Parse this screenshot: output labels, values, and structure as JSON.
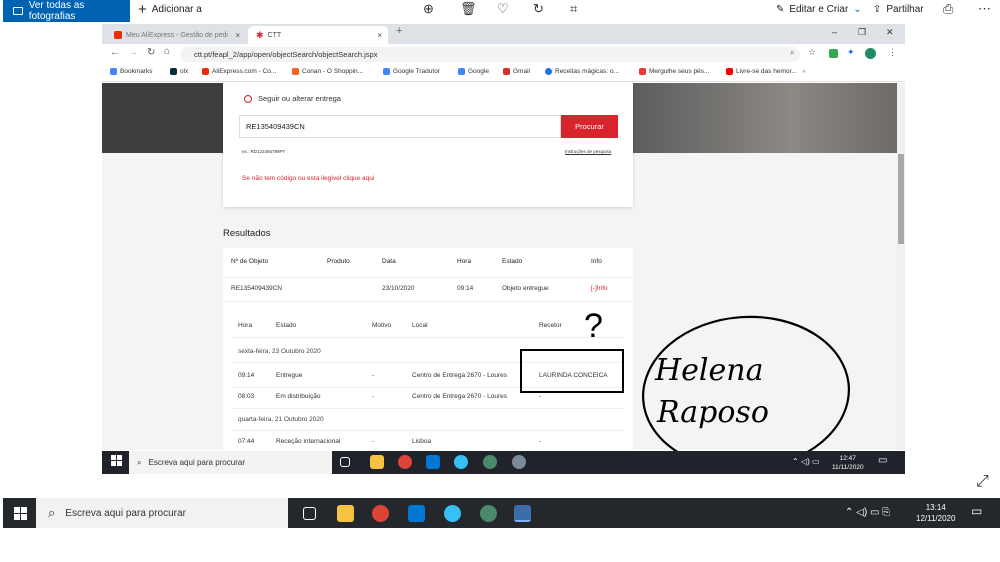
{
  "photos_toolbar": {
    "see_all": "Ver todas as fotografias",
    "add": "Adicionar a",
    "edit_create": "Editar e Criar",
    "share": "Partilhar"
  },
  "browser": {
    "tabs": [
      {
        "label": "Meu AliExpress - Gestão de pedi"
      },
      {
        "label": "CTT"
      }
    ],
    "url": "ctt.pt/feapl_2/app/open/objectSearch/objectSearch.jspx",
    "bookmarks": [
      {
        "label": "Bookmarks",
        "color": "#4285f4"
      },
      {
        "label": "olx",
        "color": "#002f34"
      },
      {
        "label": "AliExpress.com - Co...",
        "color": "#e62e04"
      },
      {
        "label": "Conan - O Shoppin...",
        "color": "#f26522"
      },
      {
        "label": "Google Tradutor",
        "color": "#4285f4"
      },
      {
        "label": "Google",
        "color": "#4285f4"
      },
      {
        "label": "Gmail",
        "color": "#d93025"
      },
      {
        "label": "Receitas mágicas: o...",
        "color": "#1a73e8"
      },
      {
        "label": "Mergulhe seus pés...",
        "color": "#e53935"
      },
      {
        "label": "Livre-se das hemor...",
        "color": "#ff0000"
      }
    ]
  },
  "search_card": {
    "heading": "Seguir ou alterar entrega",
    "input_value": "RE135409439CN",
    "button": "Procurar",
    "example": "ex.: RD123456789PT",
    "instructions": "Instruções de pesquisa",
    "no_code": "Se não tem código ou esta ilegível clique aqui"
  },
  "results": {
    "title": "Resultados",
    "columns": [
      "Nº de Objeto",
      "Produto",
      "Data",
      "Hora",
      "Estado",
      "Info"
    ],
    "row": {
      "object": "RE135409439CN",
      "product": "",
      "date": "23/10/2020",
      "time": "09:14",
      "status": "Objeto entregue",
      "info": "[-]Info"
    },
    "detail_columns": [
      "Hora",
      "Estado",
      "Motivo",
      "Local",
      "Recetor"
    ],
    "days": [
      {
        "label": "sexta-feira, 23 Outubro 2020",
        "events": [
          {
            "time": "09:14",
            "status": "Entregue",
            "reason": "-",
            "place": "Centro de Entrega 2670 - Loures",
            "receiver": "LAURINDA CONCEICA"
          },
          {
            "time": "08:03",
            "status": "Em distribuição",
            "reason": "-",
            "place": "Centro de Entrega 2670 - Loures",
            "receiver": "-"
          }
        ]
      },
      {
        "label": "quarta-feira, 21 Outubro 2020",
        "events": [
          {
            "time": "07:44",
            "status": "Receção internacional",
            "reason": "-",
            "place": "Lisboa",
            "receiver": "-"
          }
        ]
      }
    ]
  },
  "annotation": {
    "mark": "?",
    "handwriting": [
      "Helena",
      "Raposo"
    ]
  },
  "inner_taskbar": {
    "search": "Escreva aqui para procurar",
    "time": "12:47",
    "date": "11/11/2020"
  },
  "taskbar": {
    "search": "Escreva aqui para procurar",
    "time": "13:14",
    "date": "12/11/2020"
  }
}
